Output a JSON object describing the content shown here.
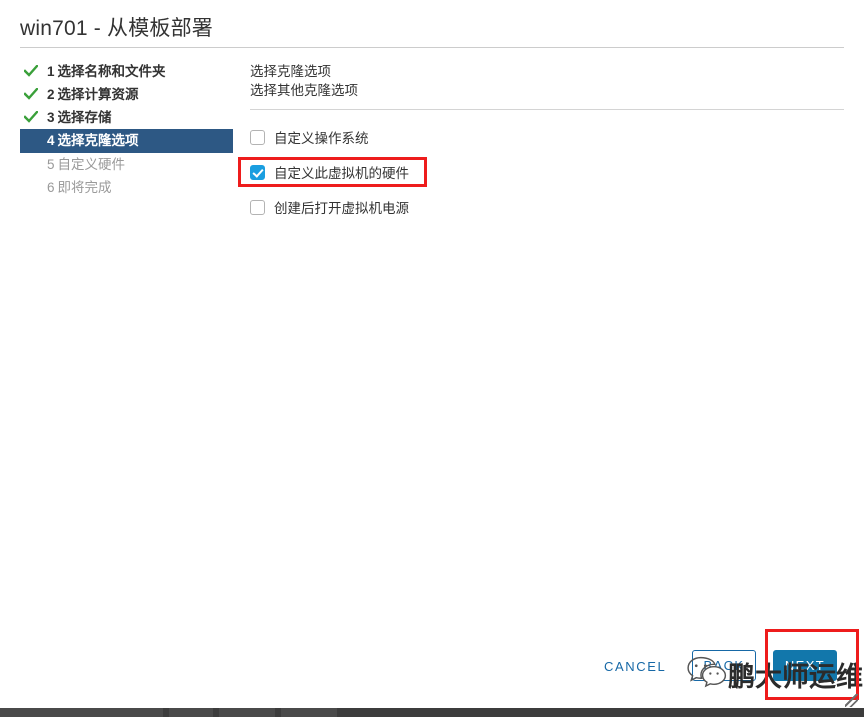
{
  "window": {
    "title": "win701 - 从模板部署"
  },
  "steps": [
    {
      "num": "1",
      "label": "选择名称和文件夹",
      "state": "done",
      "icon": "check-icon"
    },
    {
      "num": "2",
      "label": "选择计算资源",
      "state": "done",
      "icon": "check-icon"
    },
    {
      "num": "3",
      "label": "选择存储",
      "state": "done",
      "icon": "check-icon"
    },
    {
      "num": "4",
      "label": "选择克隆选项",
      "state": "active",
      "icon": ""
    },
    {
      "num": "5",
      "label": "自定义硬件",
      "state": "todo",
      "icon": ""
    },
    {
      "num": "6",
      "label": "即将完成",
      "state": "todo",
      "icon": ""
    }
  ],
  "content": {
    "heading": "选择克隆选项",
    "subheading": "选择其他克隆选项",
    "options": [
      {
        "label": "自定义操作系统",
        "checked": false
      },
      {
        "label": "自定义此虚拟机的硬件",
        "checked": true
      },
      {
        "label": "创建后打开虚拟机电源",
        "checked": false
      }
    ]
  },
  "footer": {
    "cancel_label": "CANCEL",
    "back_label": "BACK",
    "next_label": "NEXT"
  },
  "annotations": [
    {
      "name": "highlight-customize-hardware"
    },
    {
      "name": "highlight-next-button"
    }
  ],
  "watermark": {
    "text": "鹏大师运维",
    "logo": "wechat-icon"
  },
  "colors": {
    "active_step": "#2d5884",
    "checkbox_checked": "#1a9ee0",
    "primary_button": "#1277ab",
    "link": "#1668a6",
    "annotation": "#ee1c1c",
    "check_mark": "#3aa03a"
  }
}
